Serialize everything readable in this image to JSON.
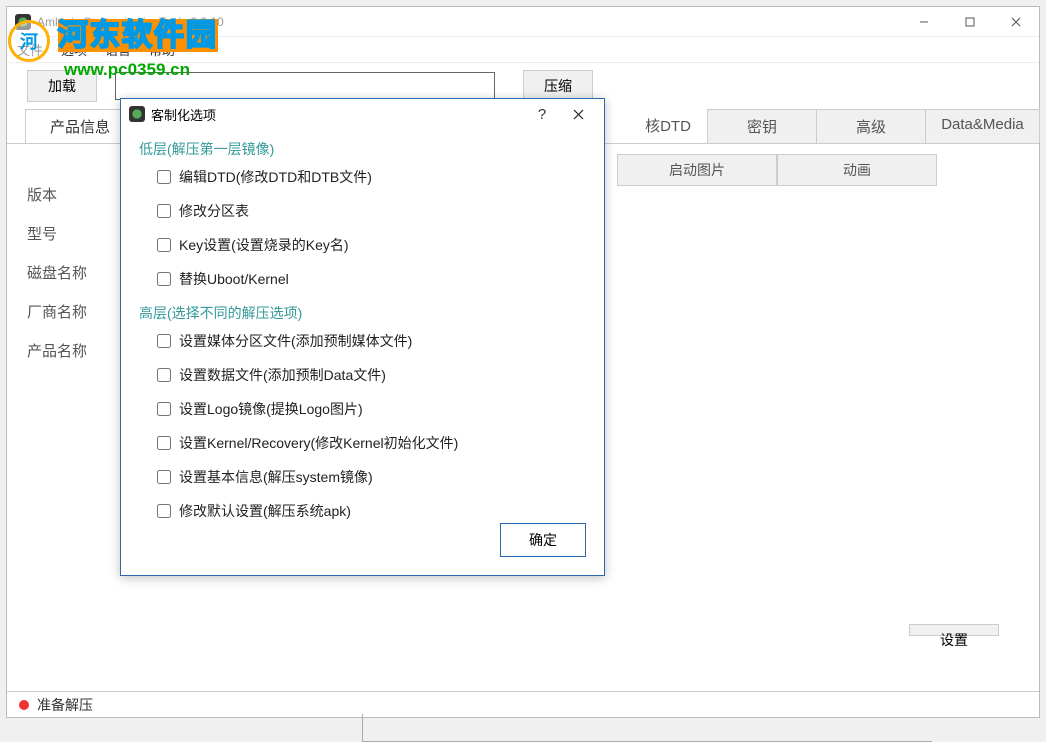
{
  "watermark": {
    "text": "河东软件园",
    "url": "www.pc0359.cn"
  },
  "window": {
    "title": "Amlogic CustomizationTool v2.0.10"
  },
  "menu": {
    "file": "文件",
    "options": "选项",
    "language": "语言",
    "help": "帮助"
  },
  "toolbar": {
    "load": "加载",
    "path": "",
    "compress": "压缩"
  },
  "tabs": {
    "product_info": "产品信息",
    "kernel_dtd": "核DTD",
    "key": "密钥",
    "advanced": "高级",
    "data_media": "Data&Media"
  },
  "sub_tabs": {
    "boot_image": "启动图片",
    "animation": "动画"
  },
  "labels": {
    "version": "版本",
    "model": "型号",
    "disk_name": "磁盘名称",
    "vendor": "厂商名称",
    "product": "产品名称"
  },
  "buttons": {
    "settings": "设置"
  },
  "status": {
    "text": "准备解压"
  },
  "dialog": {
    "title": "客制化选项",
    "group_low": "低层(解压第一层镜像)",
    "low": [
      "编辑DTD(修改DTD和DTB文件)",
      "修改分区表",
      "Key设置(设置烧录的Key名)",
      "替换Uboot/Kernel"
    ],
    "group_high": "高层(选择不同的解压选项)",
    "high": [
      "设置媒体分区文件(添加预制媒体文件)",
      "设置数据文件(添加预制Data文件)",
      "设置Logo镜像(提换Logo图片)",
      "设置Kernel/Recovery(修改Kernel初始化文件)",
      "设置基本信息(解压system镜像)",
      "修改默认设置(解压系统apk)"
    ],
    "ok": "确定"
  }
}
